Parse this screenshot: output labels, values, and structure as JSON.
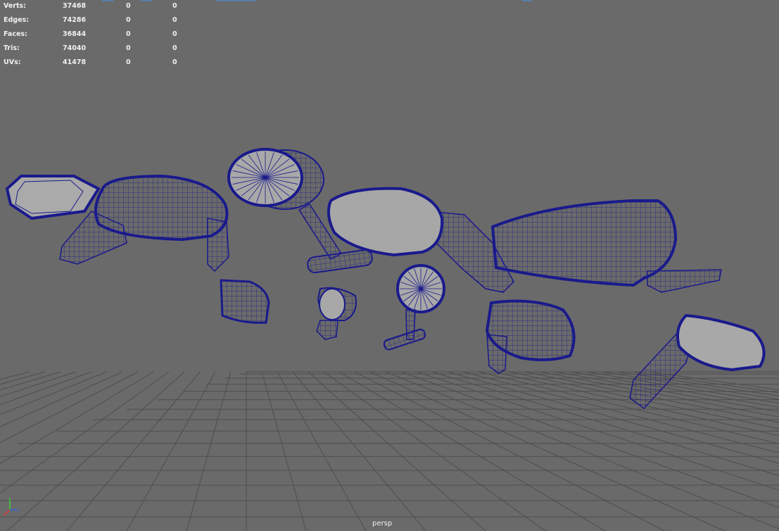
{
  "hud": {
    "rows": [
      {
        "label": "Verts:",
        "values": [
          "37468",
          "0",
          "0"
        ]
      },
      {
        "label": "Edges:",
        "values": [
          "74286",
          "0",
          "0"
        ]
      },
      {
        "label": "Faces:",
        "values": [
          "36844",
          "0",
          "0"
        ]
      },
      {
        "label": "Tris:",
        "values": [
          "74040",
          "0",
          "0"
        ]
      },
      {
        "label": "UVs:",
        "values": [
          "41478",
          "0",
          "0"
        ]
      }
    ]
  },
  "viewport": {
    "camera_label": "persp",
    "background": "#6a6a6a",
    "grid_color": "#4e4e4e",
    "wire_color": "#1a1a8c",
    "surface_color": "#a8a8a8"
  },
  "axis": {
    "x": "x",
    "y": "y",
    "z": "z"
  }
}
